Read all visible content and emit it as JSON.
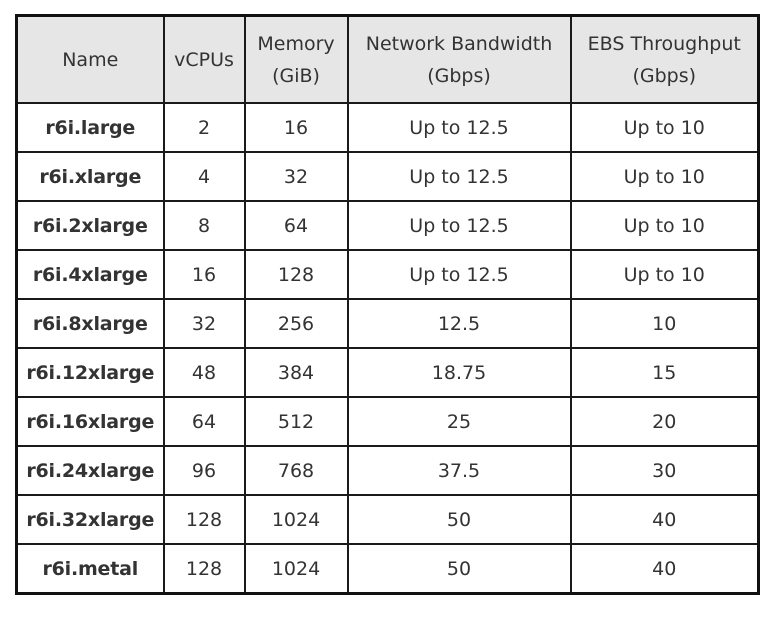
{
  "table": {
    "headers": [
      {
        "line1": "Name",
        "line2": ""
      },
      {
        "line1": "vCPUs",
        "line2": ""
      },
      {
        "line1": "Memory",
        "line2": "(GiB)"
      },
      {
        "line1": "Network Bandwidth",
        "line2": "(Gbps)"
      },
      {
        "line1": "EBS Throughput",
        "line2": "(Gbps)"
      }
    ],
    "rows": [
      [
        "r6i.large",
        "2",
        "16",
        "Up to 12.5",
        "Up to 10"
      ],
      [
        "r6i.xlarge",
        "4",
        "32",
        "Up to 12.5",
        "Up to 10"
      ],
      [
        "r6i.2xlarge",
        "8",
        "64",
        "Up to 12.5",
        "Up to 10"
      ],
      [
        "r6i.4xlarge",
        "16",
        "128",
        "Up to 12.5",
        "Up to 10"
      ],
      [
        "r6i.8xlarge",
        "32",
        "256",
        "12.5",
        "10"
      ],
      [
        "r6i.12xlarge",
        "48",
        "384",
        "18.75",
        "15"
      ],
      [
        "r6i.16xlarge",
        "64",
        "512",
        "25",
        "20"
      ],
      [
        "r6i.24xlarge",
        "96",
        "768",
        "37.5",
        "30"
      ],
      [
        "r6i.32xlarge",
        "128",
        "1024",
        "50",
        "40"
      ],
      [
        "r6i.metal",
        "128",
        "1024",
        "50",
        "40"
      ]
    ]
  }
}
